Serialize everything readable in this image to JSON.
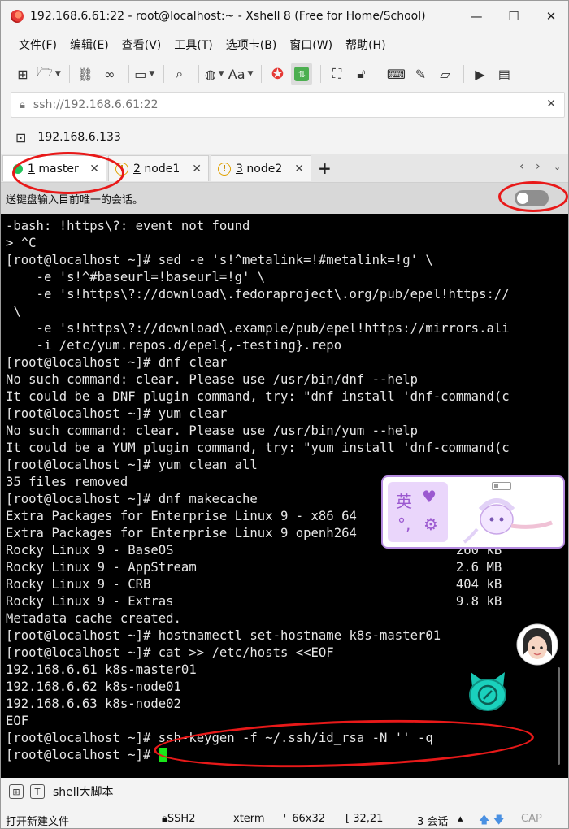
{
  "window": {
    "title": "192.168.6.61:22 - root@localhost:~ - Xshell 8 (Free for Home/School)",
    "controls": {
      "minimize": "—",
      "maximize": "☐",
      "close": "✕"
    }
  },
  "menu": [
    "文件(F)",
    "编辑(E)",
    "查看(V)",
    "工具(T)",
    "选项卡(B)",
    "窗口(W)",
    "帮助(H)"
  ],
  "toolbar": {
    "icons": [
      "new-session-icon",
      "open-folder-icon",
      "disconnect-icon",
      "reconnect-icon",
      "new-tab-icon",
      "search-icon",
      "globe-icon",
      "font-icon",
      "xshell-logo-icon",
      "xftp-icon",
      "fullscreen-icon",
      "lock-icon",
      "keyboard-icon",
      "pen-icon",
      "compose-icon",
      "script-icon",
      "log-icon"
    ],
    "font_label": "Aa"
  },
  "address": {
    "placeholder": "ssh://192.168.6.61:22"
  },
  "session": {
    "label": "192.168.6.133"
  },
  "tabs": [
    {
      "label": "1 master",
      "num": "1",
      "name": "master",
      "status": "connected",
      "close": "✕"
    },
    {
      "label": "2 node1",
      "num": "2",
      "name": "node1",
      "status": "warning",
      "close": "✕"
    },
    {
      "label": "3 node2",
      "num": "3",
      "name": "node2",
      "status": "warning",
      "close": "✕"
    }
  ],
  "tab_add": "+",
  "compose": {
    "text": "送键盘输入目前唯一的会话。",
    "toggle_on": false
  },
  "terminal": {
    "lines": [
      "-bash: !https\\?: event not found",
      "> ^C",
      "[root@localhost ~]# sed -e 's!^metalink=!#metalink=!g' \\",
      "    -e 's!^#baseurl=!baseurl=!g' \\",
      "    -e 's!https\\?://download\\.fedoraproject\\.org/pub/epel!https://",
      " \\",
      "    -e 's!https\\?://download\\.example/pub/epel!https://mirrors.ali",
      "    -i /etc/yum.repos.d/epel{,-testing}.repo",
      "[root@localhost ~]# dnf clear",
      "No such command: clear. Please use /usr/bin/dnf --help",
      "It could be a DNF plugin command, try: \"dnf install 'dnf-command(c",
      "[root@localhost ~]# yum clear",
      "No such command: clear. Please use /usr/bin/yum --help",
      "It could be a YUM plugin command, try: \"yum install 'dnf-command(c",
      "[root@localhost ~]# yum clean all",
      "35 files removed",
      "[root@localhost ~]# dnf makecache",
      "Extra Packages for Enterprise Linux 9 - x86_64",
      "Extra Packages for Enterprise Linux 9 openh264",
      "Rocky Linux 9 - BaseOS                                     260 kB",
      "Rocky Linux 9 - AppStream                                  2.6 MB",
      "Rocky Linux 9 - CRB                                        404 kB",
      "Rocky Linux 9 - Extras                                     9.8 kB",
      "Metadata cache created.",
      "[root@localhost ~]# hostnamectl set-hostname k8s-master01",
      "[root@localhost ~]# cat >> /etc/hosts <<EOF",
      "192.168.6.61 k8s-master01",
      "192.168.6.62 k8s-node01",
      "192.168.6.63 k8s-node02",
      "EOF",
      "[root@localhost ~]# ssh-keygen -f ~/.ssh/id_rsa -N '' -q",
      "[root@localhost ~]# "
    ]
  },
  "widget": {
    "glyph_1": "英",
    "glyph_2": "♥",
    "glyph_3": "°,",
    "glyph_4": "⚙"
  },
  "bottom_strip": {
    "label": "shell大脚本"
  },
  "status": {
    "hint": "打开新建文件",
    "protocol": "SSH2",
    "terminal_type": "xterm",
    "size": "66x32",
    "cursor_pos": "32,21",
    "sessions": "3 会话",
    "caps": "CAP"
  },
  "colors": {
    "cursor": "#19e619",
    "annotation": "#e81919",
    "connected": "#21c45b"
  }
}
